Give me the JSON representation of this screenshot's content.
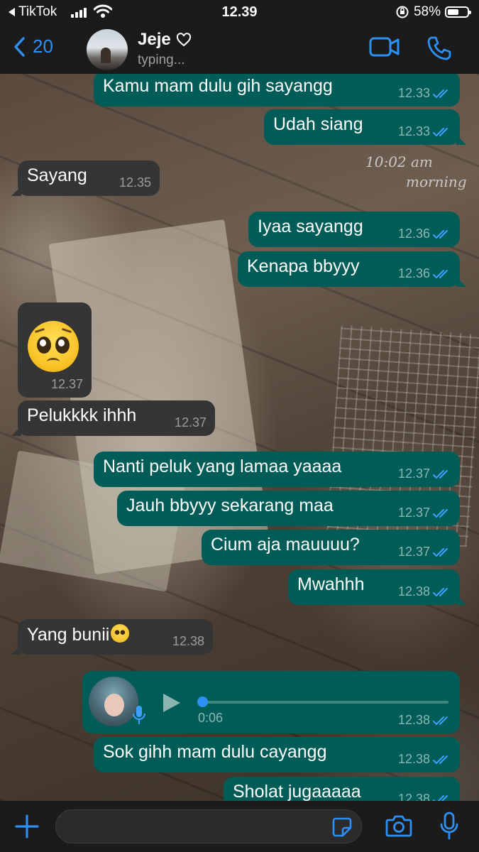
{
  "status_bar": {
    "back_app": "TikTok",
    "time": "12.39",
    "battery": "58%",
    "battery_level": 0.58
  },
  "header": {
    "back_count": "20",
    "contact_name": "Jeje",
    "contact_status": "typing...",
    "icons": [
      "chevron-left-icon",
      "heart-outline-icon",
      "video-call-icon",
      "phone-icon"
    ]
  },
  "wallpaper": {
    "time_text": "10:02 am",
    "greeting_text": "morning"
  },
  "messages": [
    {
      "dir": "out",
      "text": "Kamu mam dulu gih sayangg",
      "time": "12.33"
    },
    {
      "dir": "out",
      "text": "Udah siang",
      "time": "12.33"
    },
    {
      "dir": "in",
      "text": "Sayang",
      "time": "12.35"
    },
    {
      "dir": "out",
      "text": "Iyaa sayangg",
      "time": "12.36"
    },
    {
      "dir": "out",
      "text": "Kenapa bbyyy",
      "time": "12.36"
    },
    {
      "dir": "in",
      "type": "emoji",
      "emoji": "pleading-face",
      "time": "12.37"
    },
    {
      "dir": "in",
      "text": "Pelukkkk ihhh",
      "time": "12.37"
    },
    {
      "dir": "out",
      "text": "Nanti peluk yang lamaa yaaaa",
      "time": "12.37"
    },
    {
      "dir": "out",
      "text": "Jauh bbyyy sekarang maa",
      "time": "12.37"
    },
    {
      "dir": "out",
      "text": "Cium aja mauuuu?",
      "time": "12.37"
    },
    {
      "dir": "out",
      "text": "Mwahhh",
      "time": "12.38"
    },
    {
      "dir": "in",
      "text": "Yang bunii",
      "emoji": "pleading-face",
      "time": "12.38"
    },
    {
      "dir": "out",
      "type": "voice",
      "duration": "0:06",
      "progress": 0.0,
      "time": "12.38"
    },
    {
      "dir": "out",
      "text": "Sok gihh mam dulu cayangg",
      "time": "12.38"
    },
    {
      "dir": "out",
      "text": "Sholat jugaaaaa",
      "time": "12.38"
    }
  ],
  "input_bar": {
    "icons": [
      "plus-icon",
      "sticker-icon",
      "camera-icon",
      "microphone-icon"
    ]
  },
  "colors": {
    "outgoing_bubble": "#005c56",
    "incoming_bubble": "#353535",
    "accent": "#2d90f5",
    "bar_background": "#1b1b1b"
  }
}
